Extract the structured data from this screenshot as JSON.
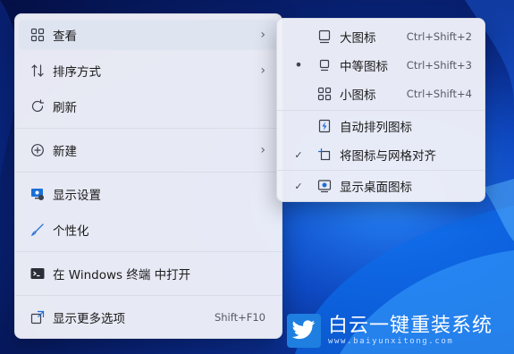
{
  "context_menu": {
    "items": [
      {
        "label": "查看",
        "icon": "grid-icon",
        "has_submenu": true
      },
      {
        "label": "排序方式",
        "icon": "sort-icon",
        "has_submenu": true
      },
      {
        "label": "刷新",
        "icon": "refresh-icon"
      },
      {
        "label": "新建",
        "icon": "plus-circle-icon",
        "has_submenu": true
      },
      {
        "label": "显示设置",
        "icon": "display-settings-icon"
      },
      {
        "label": "个性化",
        "icon": "brush-icon"
      },
      {
        "label": "在 Windows 终端 中打开",
        "icon": "terminal-icon"
      },
      {
        "label": "显示更多选项",
        "icon": "expand-icon",
        "shortcut": "Shift+F10"
      }
    ]
  },
  "view_submenu": {
    "items": [
      {
        "label": "大图标",
        "icon": "large-icons-icon",
        "shortcut": "Ctrl+Shift+2"
      },
      {
        "label": "中等图标",
        "icon": "medium-icons-icon",
        "shortcut": "Ctrl+Shift+3",
        "selected": true
      },
      {
        "label": "小图标",
        "icon": "small-icons-icon",
        "shortcut": "Ctrl+Shift+4"
      },
      {
        "label": "自动排列图标",
        "icon": "auto-arrange-icon"
      },
      {
        "label": "将图标与网格对齐",
        "icon": "align-grid-icon",
        "checked": true
      },
      {
        "label": "显示桌面图标",
        "icon": "show-desktop-icon",
        "checked": true
      }
    ],
    "check_glyph": "✓",
    "bullet_glyph": "•"
  },
  "watermark": {
    "title": "白云一键重装系统",
    "url": "www.baiyunxitong.com"
  },
  "colors": {
    "accent": "#1f7fe0",
    "menu_bg": "#eef0f8",
    "wallpaper": "#0a43b5"
  }
}
